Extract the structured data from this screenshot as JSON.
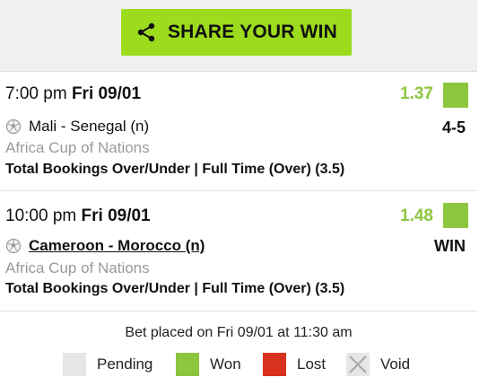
{
  "share": {
    "label": "SHARE YOUR WIN",
    "icon": "share-icon"
  },
  "selections": [
    {
      "time": "7:00 pm",
      "date": "Fri 09/01",
      "odds": "1.37",
      "status": "won",
      "event": "Mali - Senegal (n)",
      "result": "4-5",
      "competition": "Africa Cup of Nations",
      "market": "Total Bookings Over/Under | Full Time (Over) (3.5)"
    },
    {
      "time": "10:00 pm",
      "date": "Fri 09/01",
      "odds": "1.48",
      "status": "won",
      "event": "Cameroon - Morocco (n)",
      "result": "WIN",
      "competition": "Africa Cup of Nations",
      "market": "Total Bookings Over/Under | Full Time (Over) (3.5)"
    }
  ],
  "footer": {
    "bet_placed": "Bet placed on Fri 09/01 at 11:30 am",
    "legend": [
      {
        "label": "Pending",
        "color": "#e6e6e6"
      },
      {
        "label": "Won",
        "color": "#8cc63f"
      },
      {
        "label": "Lost",
        "color": "#d8321e"
      },
      {
        "label": "Void",
        "color": "#e6e6e6"
      }
    ]
  },
  "colors": {
    "share_button": "#9cdc1c",
    "odds": "#8cc63f",
    "won": "#8cc63f",
    "lost": "#d8321e",
    "pending": "#e6e6e6"
  }
}
